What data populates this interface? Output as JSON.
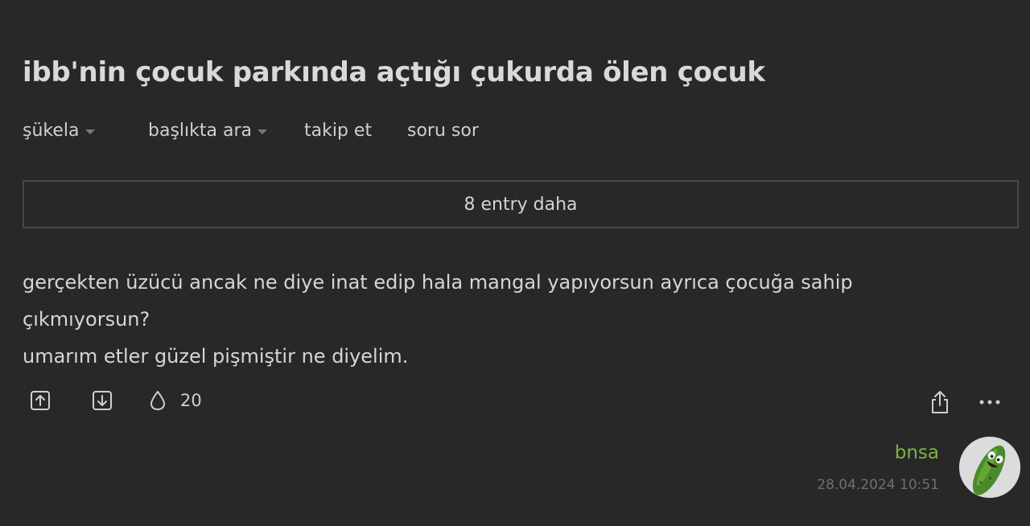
{
  "topic": {
    "title": "ibb'nin çocuk parkında açtığı çukurda ölen çocuk"
  },
  "toolbar": {
    "sort_label": "şükela",
    "search_label": "başlıkta ara",
    "follow_label": "takip et",
    "ask_label": "soru sor"
  },
  "more_entries": {
    "label": "8 entry daha"
  },
  "entry": {
    "lines": [
      "gerçekten üzücü ancak ne diye inat edip hala mangal yapıyorsun ayrıca çocuğa sahip",
      "çıkmıyorsun?",
      "umarım etler güzel pişmiştir ne diyelim."
    ],
    "favorite_count": "20",
    "author": "bnsa",
    "date": "28.04.2024 10:51"
  },
  "colors": {
    "background": "#282828",
    "text": "#d6d6d6",
    "author": "#7cb342",
    "border": "#484848",
    "muted": "#6f6f6f"
  },
  "icons": {
    "upvote": "upvote-icon",
    "downvote": "downvote-icon",
    "favorite": "drop-icon",
    "share": "share-icon",
    "more": "more-dots-icon",
    "avatar": "pickle-avatar"
  }
}
